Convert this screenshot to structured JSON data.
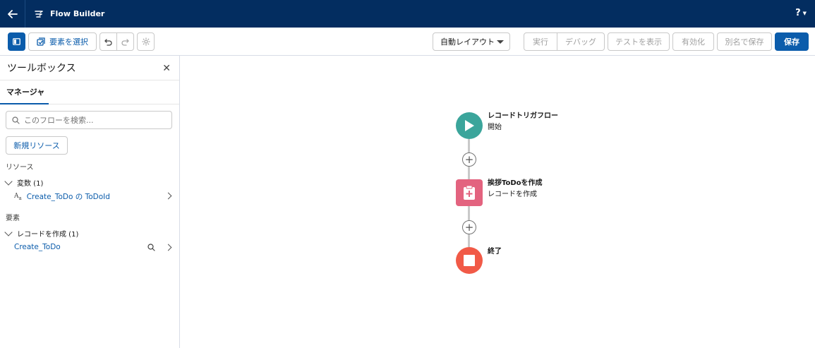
{
  "topbar": {
    "title": "Flow Builder",
    "help": "?"
  },
  "toolbar": {
    "select_elements": "要素を選択",
    "layout": "自動レイアウト",
    "run": "実行",
    "debug": "デバッグ",
    "view_tests": "テストを表示",
    "activate": "有効化",
    "save_as": "別名で保存",
    "save": "保存"
  },
  "sidebar": {
    "title": "ツールボックス",
    "tab": "マネージャ",
    "search_placeholder": "このフローを検索...",
    "new_resource": "新規リソース",
    "resources_label": "リソース",
    "variables_group": "変数 (1)",
    "variable_item": "Create_ToDo の ToDoId",
    "elements_label": "要素",
    "create_records_group": "レコードを作成 (1)",
    "create_item": "Create_ToDo"
  },
  "canvas": {
    "start": {
      "title": "レコードトリガフロー",
      "subtitle": "開始"
    },
    "create": {
      "title": "挨拶ToDoを作成",
      "subtitle": "レコードを作成"
    },
    "end": {
      "title": "終了"
    }
  },
  "colors": {
    "topbar": "#032d60",
    "brand": "#0b5cab",
    "start_node": "#3ba59b",
    "create_node": "#e3637f",
    "end_node": "#f15a47"
  }
}
